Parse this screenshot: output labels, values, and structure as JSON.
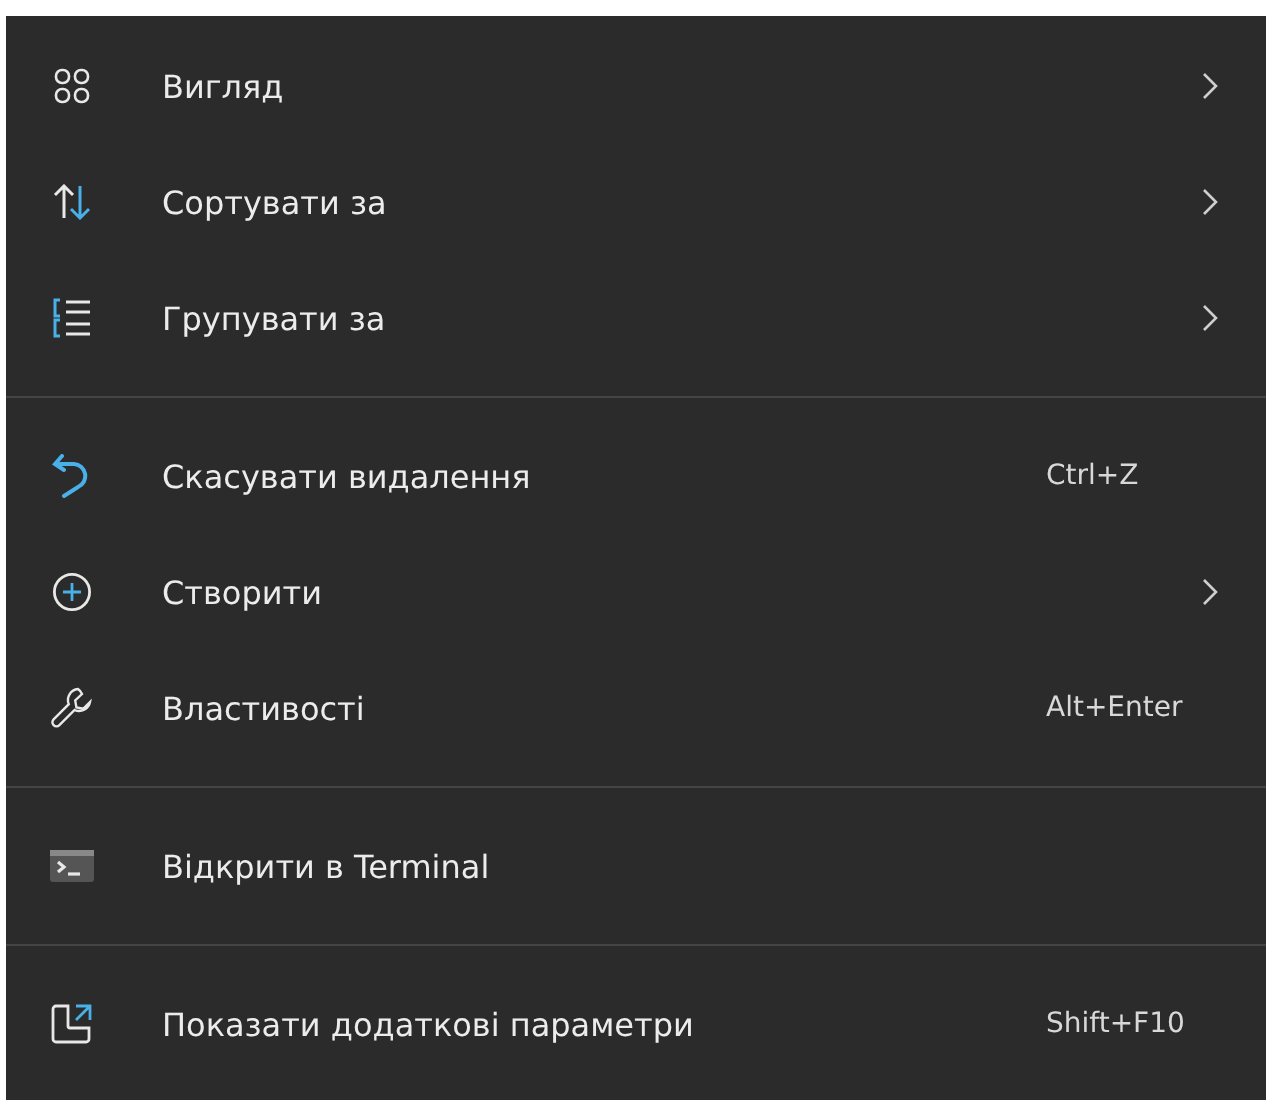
{
  "menu": {
    "sections": [
      {
        "items": [
          {
            "label": "Вигляд",
            "submenu": true
          },
          {
            "label": "Сортувати за",
            "submenu": true
          },
          {
            "label": "Групувати за",
            "submenu": true
          }
        ]
      },
      {
        "items": [
          {
            "label": "Скасувати видалення",
            "submenu": false,
            "shortcut": "Ctrl+Z"
          },
          {
            "label": "Створити",
            "submenu": true
          },
          {
            "label": "Властивості",
            "submenu": false,
            "shortcut": "Alt+Enter"
          }
        ]
      },
      {
        "items": [
          {
            "label": "Відкрити в Terminal",
            "submenu": false
          }
        ]
      },
      {
        "items": [
          {
            "label": "Показати додаткові параметри",
            "submenu": false,
            "shortcut": "Shift+F10"
          }
        ]
      }
    ]
  }
}
